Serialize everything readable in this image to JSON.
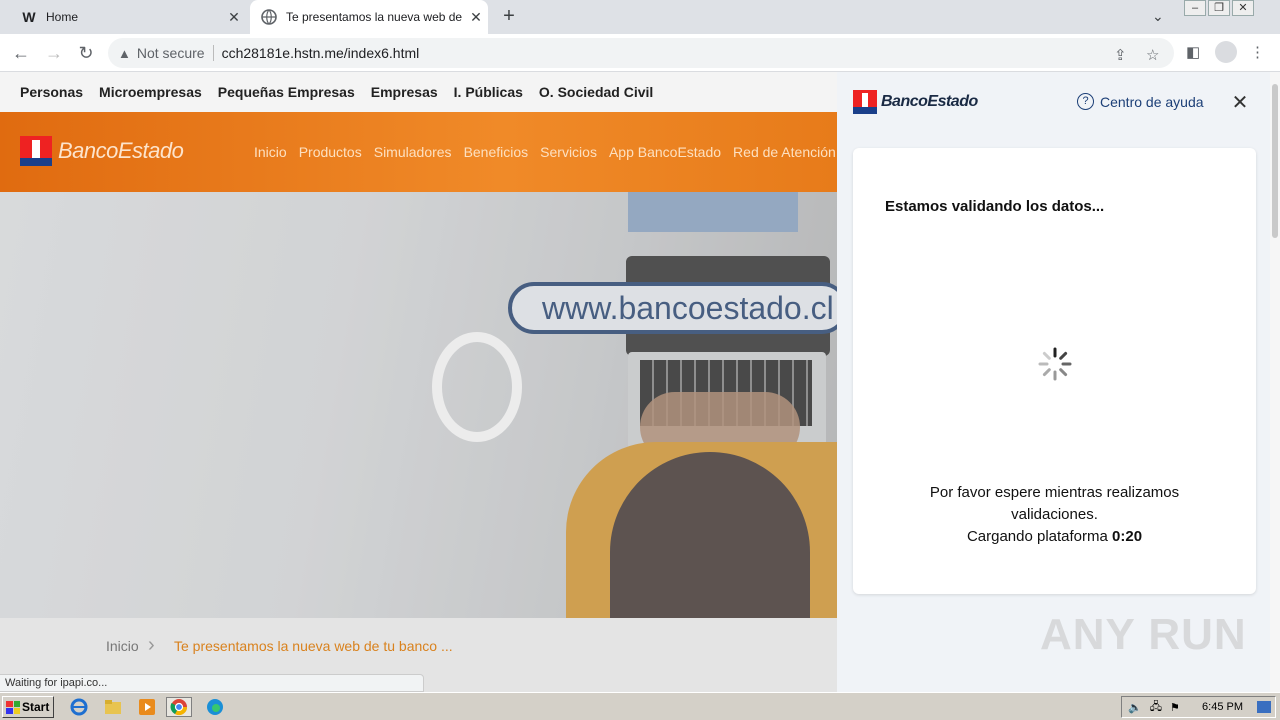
{
  "browser": {
    "tabs": [
      {
        "title": "Home",
        "icon": "wix-w-icon"
      },
      {
        "title": "Te presentamos la nueva web de tu banco",
        "icon": "globe-icon"
      }
    ],
    "address": {
      "security_label": "Not secure",
      "url": "cch28181e.hstn.me/index6.html"
    },
    "status_bubble": "Waiting for ipapi.co..."
  },
  "site": {
    "segment_nav": [
      "Personas",
      "Microempresas",
      "Pequeñas Empresas",
      "Empresas",
      "I. Públicas",
      "O. Sociedad Civil"
    ],
    "brand": "BancoEstado",
    "main_nav": [
      "Inicio",
      "Productos",
      "Simuladores",
      "Beneficios",
      "Servicios",
      "App BancoEstado",
      "Red de Atención"
    ],
    "hero_url_text": "www.bancoestado.cl",
    "breadcrumb": {
      "home": "Inicio",
      "current": "Te presentamos la nueva web de tu banco ..."
    }
  },
  "panel": {
    "brand": "BancoEstado",
    "help_label": "Centro de ayuda",
    "card_title": "Estamos validando los datos...",
    "message_line1": "Por favor espere mientras realizamos validaciones.",
    "message_line2_prefix": "Cargando plataforma",
    "countdown": "0:20"
  },
  "watermark": "ANY RUN",
  "taskbar": {
    "start_label": "Start",
    "clock": "6:45 PM"
  },
  "colors": {
    "brand_orange": "#e77b1a",
    "brand_red": "#e22222",
    "brand_blue": "#1a3f8a",
    "help_blue": "#1c3f77"
  }
}
